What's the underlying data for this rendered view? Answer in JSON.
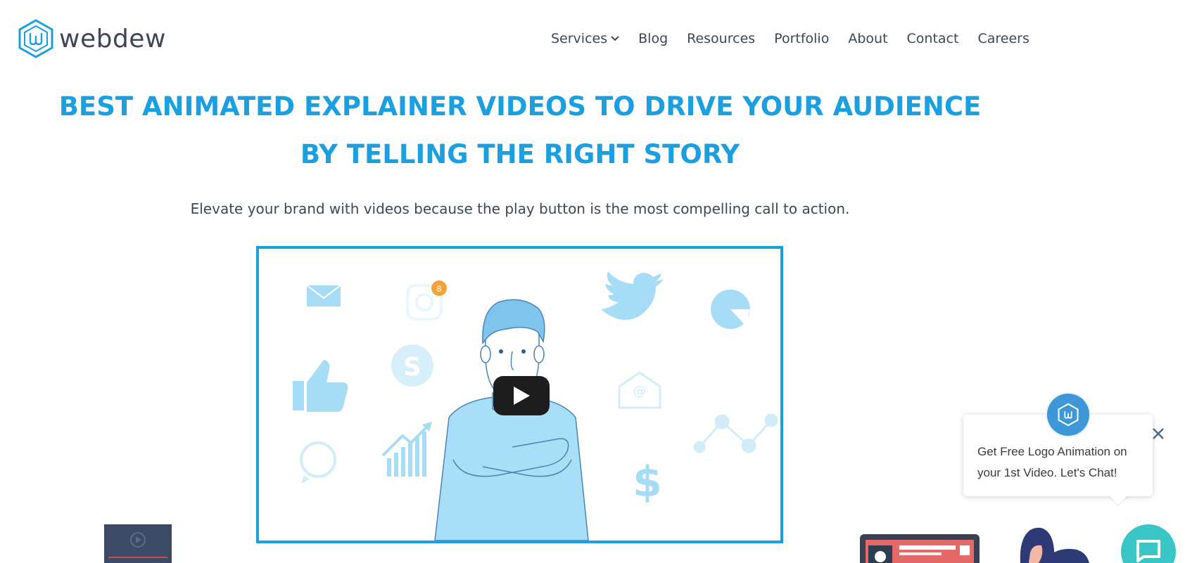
{
  "brand": {
    "name": "webdew",
    "accent": "#1aa0e1",
    "dark": "#3f4756"
  },
  "nav": {
    "items": [
      {
        "label": "Services",
        "has_dropdown": true
      },
      {
        "label": "Blog"
      },
      {
        "label": "Resources"
      },
      {
        "label": "Portfolio"
      },
      {
        "label": "About"
      },
      {
        "label": "Contact"
      },
      {
        "label": "Careers"
      }
    ]
  },
  "hero": {
    "title_line1": "BEST ANIMATED EXPLAINER VIDEOS TO DRIVE YOUR AUDIENCE",
    "title_line2": "BY TELLING THE RIGHT STORY",
    "subtitle": "Elevate your brand with videos because the play button is the most compelling call to action."
  },
  "video": {
    "badge_count": "8",
    "icons": [
      "mail-icon",
      "instagram-icon",
      "twitter-icon",
      "pie-chart-icon",
      "skype-icon",
      "thumbs-up-icon",
      "email-open-icon",
      "line-graph-icon",
      "whatsapp-icon",
      "bar-growth-icon",
      "dollar-icon"
    ]
  },
  "chat": {
    "message": "Get Free Logo Animation on your 1st Video. Let's Chat!",
    "launcher_color": "#3ac6c5"
  }
}
